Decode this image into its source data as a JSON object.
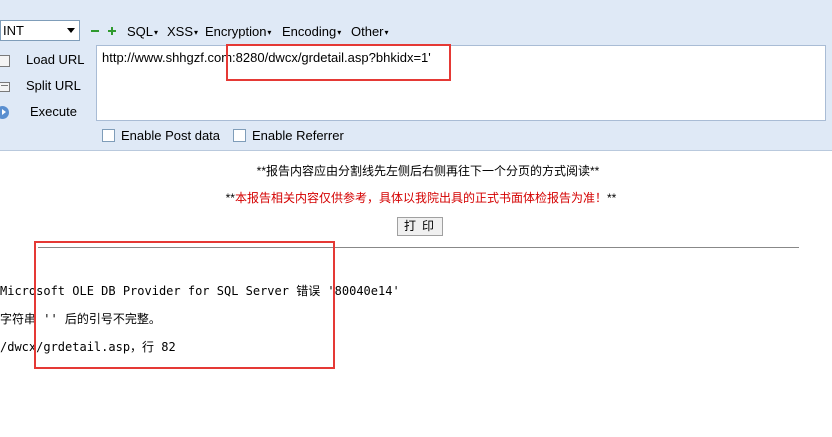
{
  "hackbar": {
    "select_value": "INT",
    "menus": [
      "SQL",
      "XSS",
      "Encryption",
      "Encoding",
      "Other"
    ],
    "side_buttons": {
      "load": "Load URL",
      "split": "Split URL",
      "execute": "Execute"
    },
    "url": "http://www.shhgzf.com:8280/dwcx/grdetail.asp?bhkidx=1'",
    "checkboxes": {
      "post": "Enable Post data",
      "referrer": "Enable Referrer"
    }
  },
  "page": {
    "note1": "**报告内容应由分割线先左侧后右侧再往下一个分页的方式阅读**",
    "note2_prefix": "**",
    "note2_text": "本报告相关内容仅供参考，具体以我院出具的正式书面体检报告为准！",
    "note2_suffix": "**",
    "print_label": "打印",
    "error_lines": [
      "Microsoft OLE DB Provider for SQL Server 错误 '80040e14'",
      "字符串 '' 后的引号不完整。",
      "/dwcx/grdetail.asp，行 82"
    ]
  },
  "colors": {
    "hackbar_bg": "#dfe9f6",
    "highlight": "#e53935",
    "warning_text": "#d40000"
  }
}
